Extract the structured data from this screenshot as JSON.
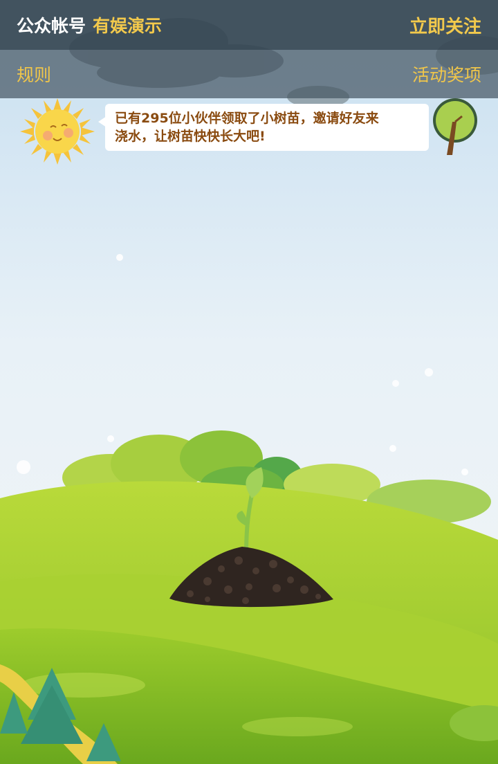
{
  "header": {
    "account_label": "公众帐号",
    "account_name": "有娱演示",
    "follow_label": "立即关注"
  },
  "subnav": {
    "rules_label": "规则",
    "prizes_label": "活动奖项"
  },
  "message": {
    "line1": "已有295位小伙伴领取了小树苗，邀请好友来",
    "line2": "浇水，让树苗快快长大吧!"
  },
  "colors": {
    "header_bg": "#364652",
    "accent_yellow": "#f2c94c",
    "message_text": "#8a4b10",
    "grass": "#9cc92a",
    "soil": "#2f2520"
  },
  "icons": {
    "sun": "sun-icon",
    "tree": "tree-icon",
    "sprout": "sprout-icon",
    "soil": "soil-mound-icon"
  }
}
